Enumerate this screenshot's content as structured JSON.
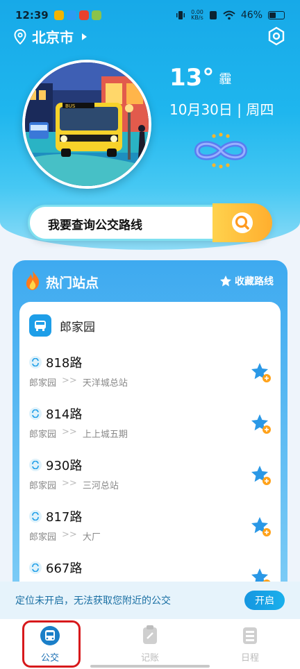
{
  "status_bar": {
    "time": "12:39",
    "net_speed_value": "0.00",
    "net_speed_unit": "KB/s",
    "battery": "46%"
  },
  "location": {
    "city": "北京市"
  },
  "weather": {
    "temp": "13°",
    "condition": "霾",
    "date": "10月30日 | 周四"
  },
  "bus_sign": "BUS",
  "search": {
    "label": "我要查询公交路线"
  },
  "hot": {
    "title": "热门站点",
    "fav_label": "收藏路线",
    "stop_name": "郎家园",
    "routes": [
      {
        "name": "818路",
        "from": "郎家园",
        "arrow": ">>",
        "to": "天洋城总站"
      },
      {
        "name": "814路",
        "from": "郎家园",
        "arrow": ">>",
        "to": "上上城五期"
      },
      {
        "name": "930路",
        "from": "郎家园",
        "arrow": ">>",
        "to": "三河总站"
      },
      {
        "name": "817路",
        "from": "郎家园",
        "arrow": ">>",
        "to": "大厂"
      },
      {
        "name": "667路",
        "from": "",
        "arrow": "",
        "to": ""
      }
    ]
  },
  "banner": {
    "text": "定位未开启，无法获取您附近的公交",
    "button": "开启"
  },
  "tabs": [
    {
      "label": "公交"
    },
    {
      "label": "记账"
    },
    {
      "label": "日程"
    }
  ],
  "colors": {
    "accent": "#1596e0",
    "highlight_outline": "#d7191c",
    "search_button": "#ffae2e"
  }
}
